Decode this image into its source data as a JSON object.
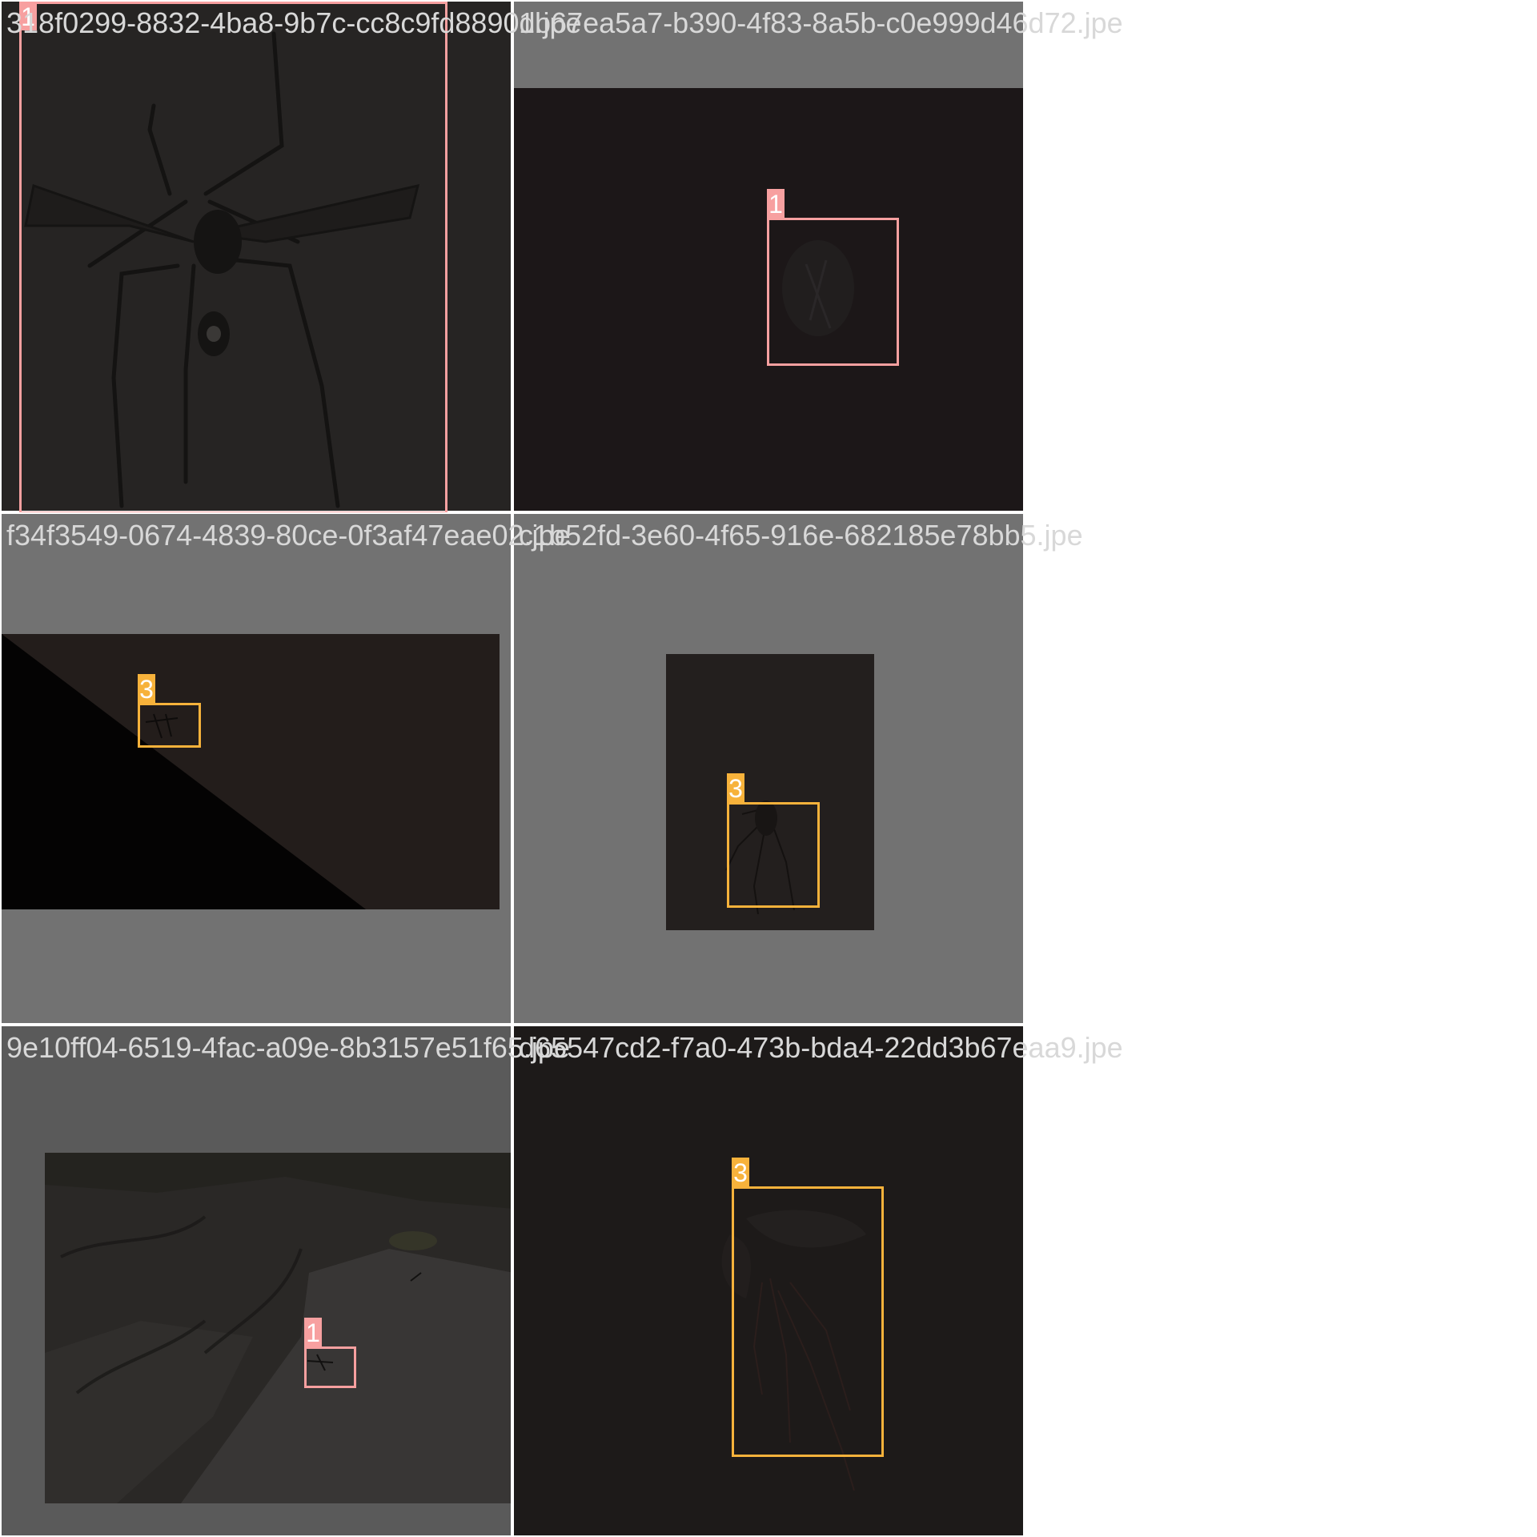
{
  "tiles": [
    {
      "filename": "318f0299-8832-4ba8-9b7c-cc8c9fd8890d.jpe",
      "boxes": [
        {
          "label": "1",
          "color": "#f7a0a0"
        }
      ]
    },
    {
      "filename": "1b67ea5a7-b390-4f83-8a5b-c0e999d46d72.jpe",
      "boxes": [
        {
          "label": "1",
          "color": "#f7a0a0"
        }
      ]
    },
    {
      "filename": "f34f3549-0674-4839-80ce-0f3af47eae02.jpe",
      "boxes": [
        {
          "label": "3",
          "color": "#f7b23b"
        }
      ]
    },
    {
      "filename": "c1b52fd-3e60-4f65-916e-682185e78bb5.jpe",
      "boxes": [
        {
          "label": "3",
          "color": "#f7b23b"
        }
      ]
    },
    {
      "filename": "9e10ff04-6519-4fac-a09e-8b3157e51f65.jpe",
      "boxes": [
        {
          "label": "1",
          "color": "#f7a0a0"
        }
      ]
    },
    {
      "filename": "d65547cd2-f7a0-473b-bda4-22dd3b67eaa9.jpe",
      "boxes": [
        {
          "label": "3",
          "color": "#f7b23b"
        }
      ]
    }
  ]
}
